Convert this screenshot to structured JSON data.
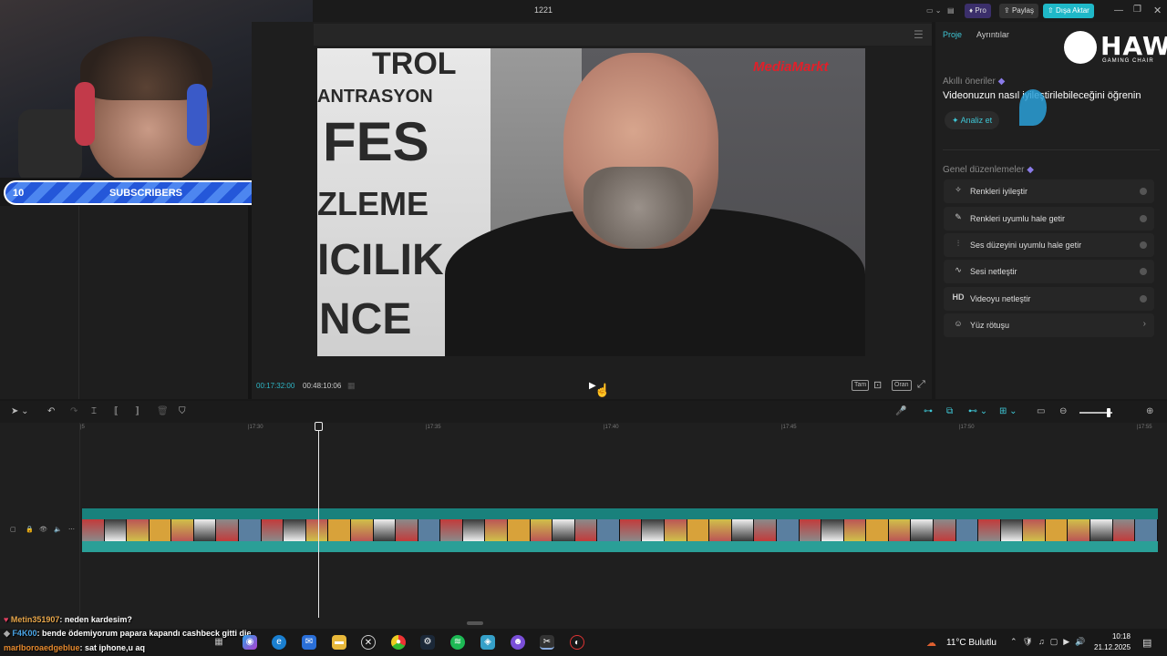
{
  "window": {
    "title": "1221",
    "pro_label": "Pro",
    "share_label": "Paylaş",
    "export_label": "Dışa Aktar"
  },
  "overlay": {
    "sub_left": "10",
    "sub_center": "SUBSCRIBERS",
    "sub_right": "10"
  },
  "preview": {
    "current_time": "00:17:32:00",
    "total_time": "00:48:10:06",
    "watermark": "MediaMarkt",
    "wall_lines": [
      "TROL",
      "ANTRASYON",
      "FES",
      "ZLEME",
      "ICILIK",
      "NCE"
    ],
    "controls": [
      "Tam",
      "Oran"
    ]
  },
  "right_panel": {
    "tabs": [
      "Proje",
      "Ayrıntılar"
    ],
    "brand": {
      "title": "HAWK",
      "subtitle": "GAMING CHAIR"
    },
    "smart_header": "Akıllı öneriler",
    "smart_desc": "Videonuzun nasıl iyileştirilebileceğini öğrenin",
    "analyze_label": "Analiz et",
    "general_header": "Genel düzenlemeler",
    "options": [
      {
        "label": "Renkleri iyileştir",
        "icon": "wand-icon"
      },
      {
        "label": "Renkleri uyumlu hale getir",
        "icon": "palette-icon"
      },
      {
        "label": "Ses düzeyini uyumlu hale getir",
        "icon": "sliders-icon"
      },
      {
        "label": "Sesi netleştir",
        "icon": "waveform-icon"
      },
      {
        "label": "Videoyu netleştir",
        "icon": "hd-icon",
        "glyph": "HD"
      },
      {
        "label": "Yüz rötuşu",
        "icon": "face-icon"
      }
    ]
  },
  "timeline": {
    "ticks": [
      "|5",
      "|17:30",
      "|17:35",
      "|17:40",
      "|17:45",
      "|17:50",
      "|17:55"
    ]
  },
  "chat": [
    {
      "user": "Metin351907",
      "text": ": neden kardesim?"
    },
    {
      "user": "F4K00",
      "text": ": bende ödemiyorum papara kapandı cashbeck gitti die"
    },
    {
      "user": "marlboroaedgeblue",
      "text": ": sat iphone,u aq"
    }
  ],
  "taskbar": {
    "weather": "11°C  Bulutlu",
    "time": "10:18",
    "date": "21.12.2025"
  },
  "colors": {
    "accent": "#3fc7d6",
    "clip": "#1b8f8a",
    "export": "#1fb8c8",
    "pro": "#3b2f6b"
  }
}
